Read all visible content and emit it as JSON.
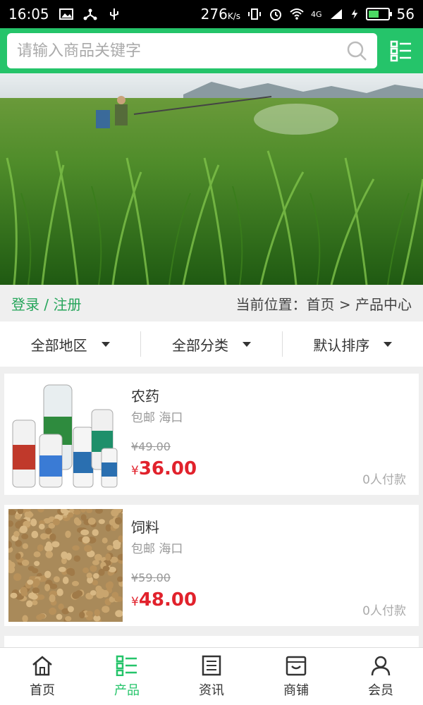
{
  "status_bar": {
    "time": "16:05",
    "speed": "276",
    "speed_unit": "K/s",
    "network": "4G",
    "battery": "56",
    "battery_level": 0.56
  },
  "search": {
    "placeholder": "请输入商品关键字"
  },
  "location_bar": {
    "login_label": "登录",
    "separator": "/",
    "register_label": "注册",
    "breadcrumb": "当前位置：首页 > 产品中心"
  },
  "filters": [
    {
      "label": "全部地区"
    },
    {
      "label": "全部分类"
    },
    {
      "label": "默认排序"
    }
  ],
  "products": [
    {
      "name": "农药",
      "shipping": "包邮 海口",
      "old_price": "¥49.00",
      "currency": "¥",
      "price": "36.00",
      "paid_count": "0人付款"
    },
    {
      "name": "饲料",
      "shipping": "包邮 海口",
      "old_price": "¥59.00",
      "currency": "¥",
      "price": "48.00",
      "paid_count": "0人付款"
    }
  ],
  "bottom_nav": [
    {
      "label": "首页",
      "icon": "home-icon"
    },
    {
      "label": "产品",
      "icon": "products-icon",
      "active": true
    },
    {
      "label": "资讯",
      "icon": "news-icon"
    },
    {
      "label": "商铺",
      "icon": "store-icon"
    },
    {
      "label": "会员",
      "icon": "member-icon"
    }
  ],
  "colors": {
    "accent": "#25c46a",
    "price_red": "#e1222c",
    "link_green": "#25a55a"
  }
}
